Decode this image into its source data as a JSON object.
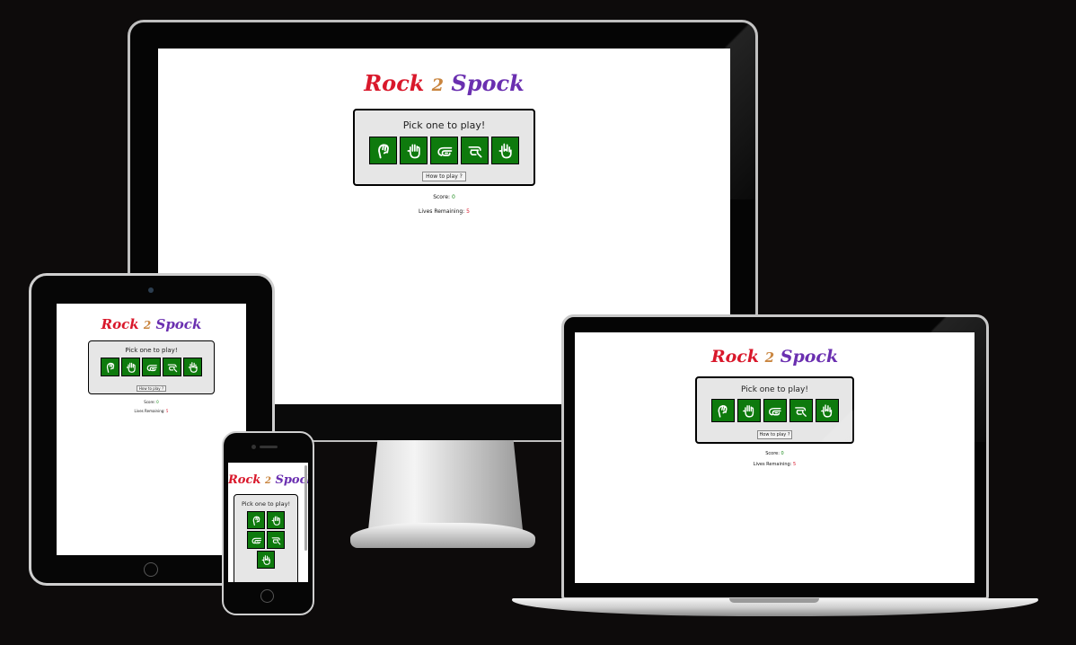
{
  "app": {
    "title_rock": "Rock",
    "title_two": "2",
    "title_spock": "Spock",
    "pick_prompt": "Pick one to play!",
    "how_to_play": "How to play ?",
    "score_label": "Score:",
    "score_value": "0",
    "lives_label": "Lives Remaining:",
    "lives_value": "5",
    "choices": [
      "rock-icon",
      "paper-icon",
      "scissors-icon",
      "lizard-icon",
      "spock-icon"
    ]
  },
  "colors": {
    "background": "#0d0b0b",
    "rock_red": "#d9182b",
    "two_orange": "#c9853f",
    "spock_purple": "#6a2fb0",
    "button_green": "#0e7a0d",
    "panel_grey": "#e6e6e6"
  },
  "devices": [
    "desktop-monitor",
    "tablet",
    "phone",
    "laptop"
  ]
}
